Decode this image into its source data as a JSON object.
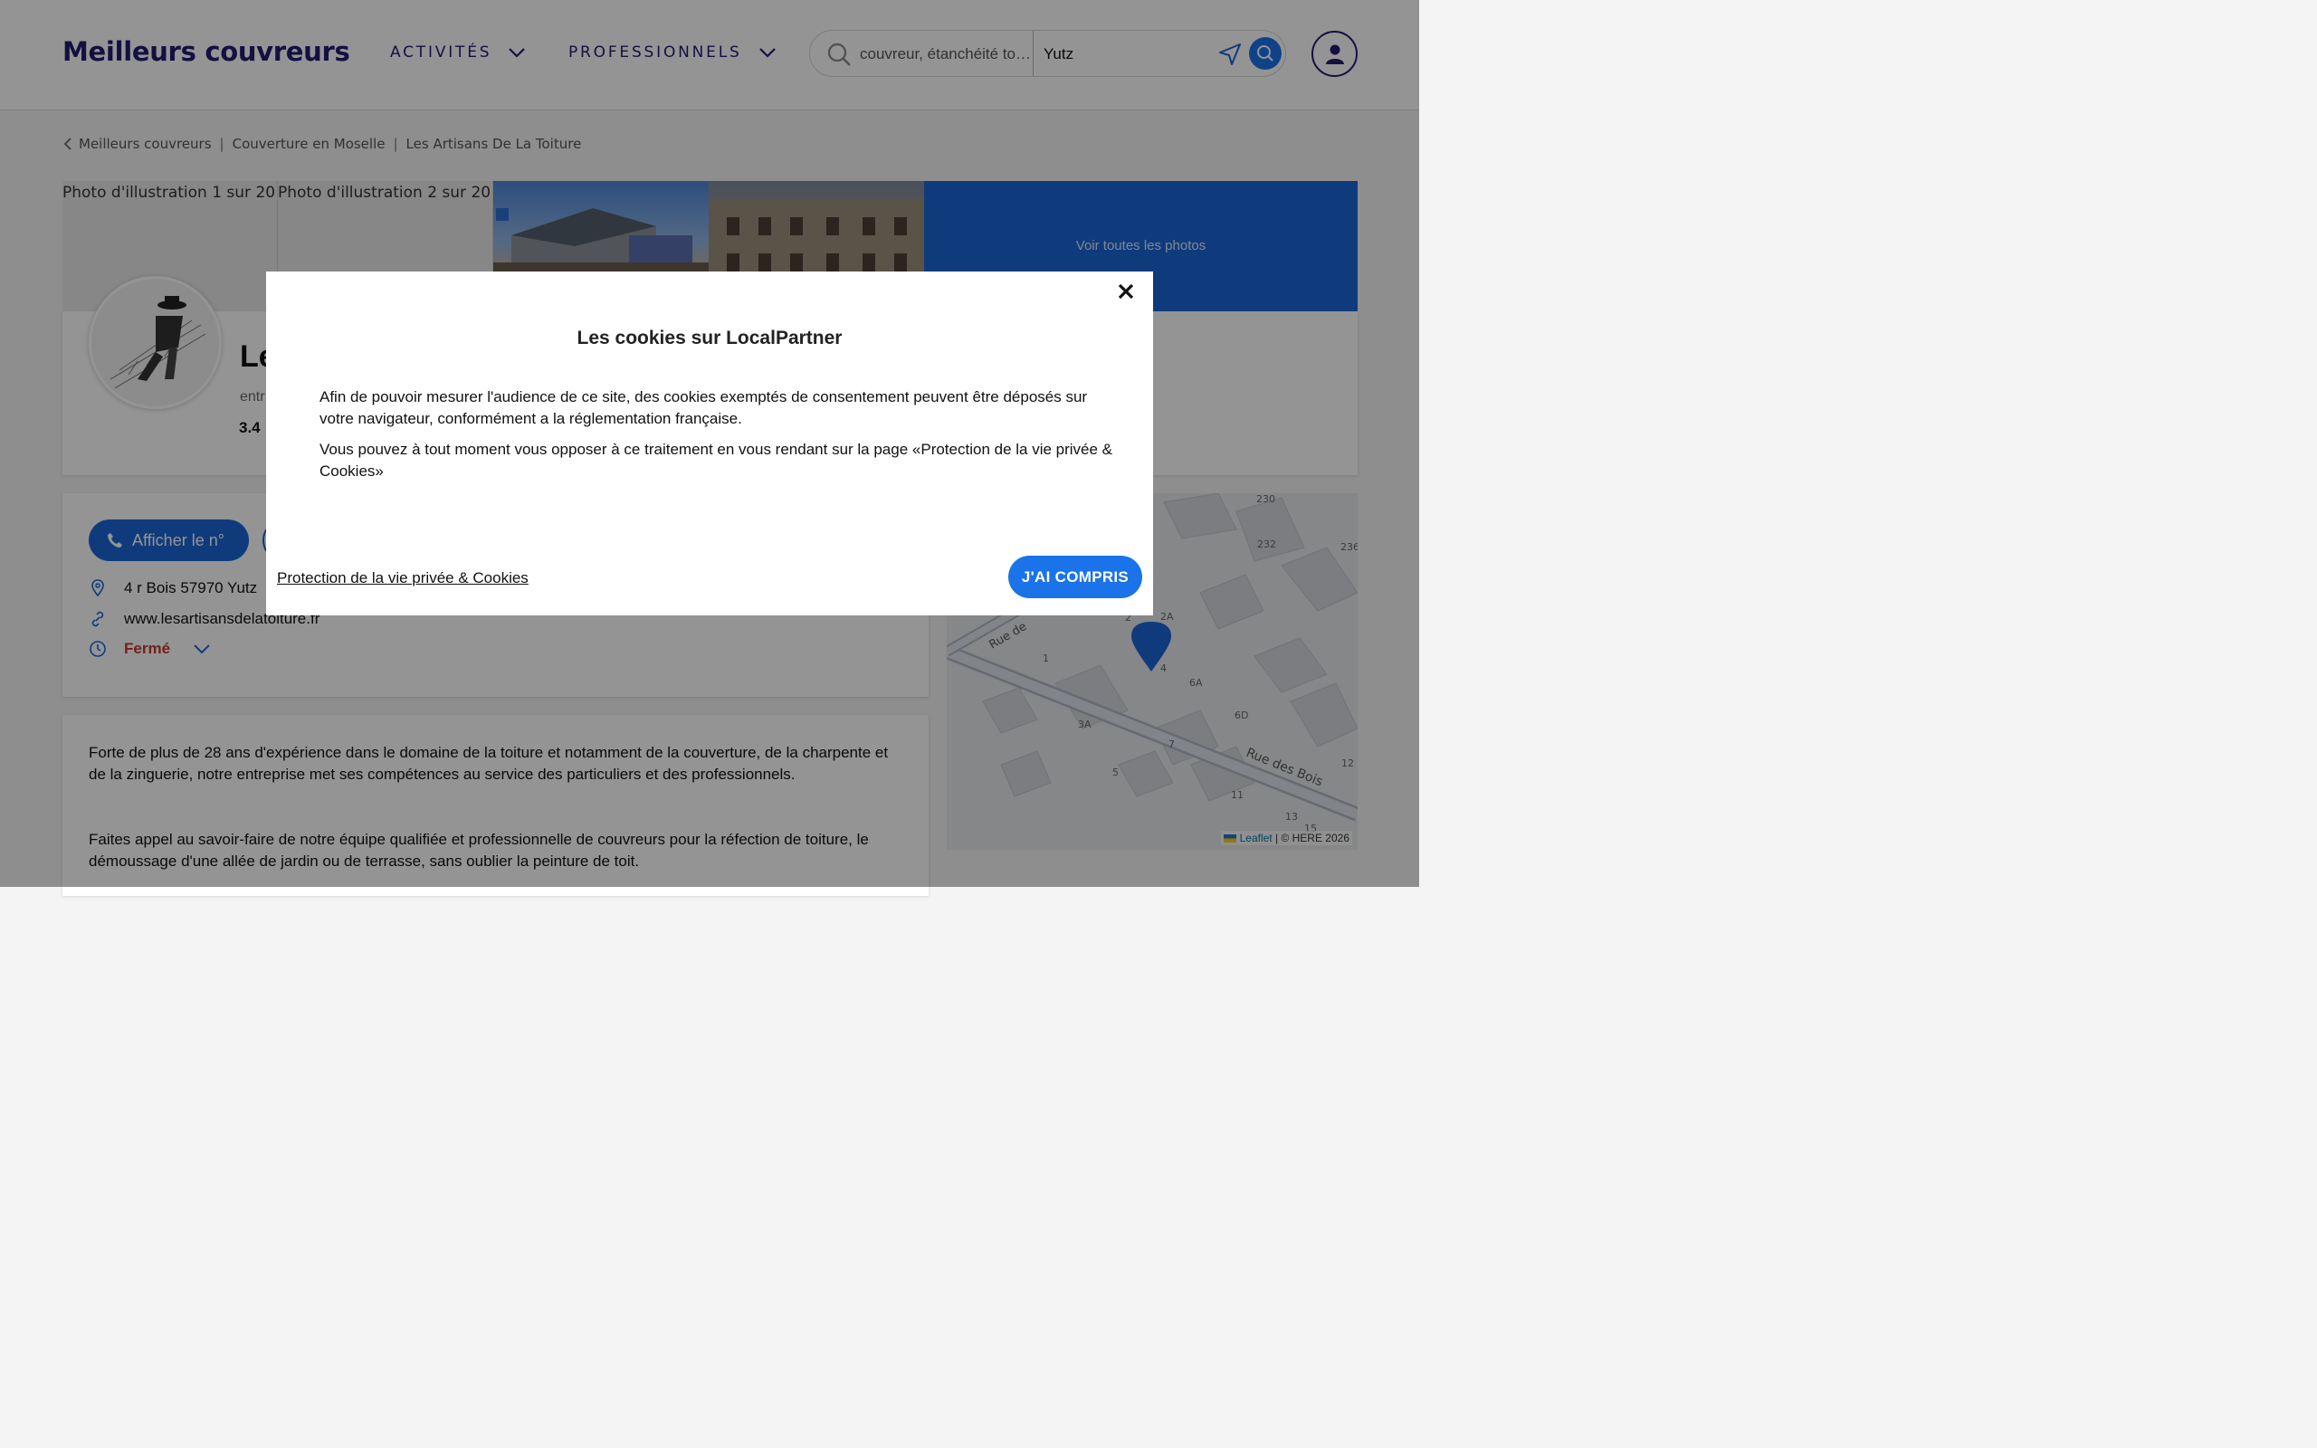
{
  "header": {
    "logo": "Meilleurs couvreurs",
    "nav": [
      {
        "label": "ACTIVITÉS"
      },
      {
        "label": "PROFESSIONNELS"
      }
    ],
    "search": {
      "what_placeholder": "couvreur, étanchéité toiture",
      "where_value": "Yutz"
    }
  },
  "breadcrumb": [
    "Meilleurs couvreurs",
    "Couverture en Moselle",
    "Les Artisans De La Toiture"
  ],
  "photos": {
    "alt1": "Photo d'illustration 1 sur 20",
    "alt2": "Photo d'illustration 2 sur 20",
    "more": "Voir toutes les photos"
  },
  "business": {
    "name": "Le",
    "subtitle": "entr",
    "rating": "3.4",
    "phone_button": "Afficher le n°",
    "address": "4 r Bois 57970 Yutz",
    "website": "www.lesartisansdelatoiture.fr",
    "hours_status": "Fermé"
  },
  "description": {
    "p1": "Forte de plus de 28 ans d'expérience dans le domaine de la toiture et notamment de la couverture, de la charpente et de la zinguerie, notre entreprise met ses compétences au service des particuliers et des professionnels.",
    "p2": "Faites appel au savoir-faire de notre équipe qualifiée et professionnelle de couvreurs pour la réfection de toiture, le démoussage d'une allée de jardin ou de terrasse, sans oublier la peinture de toit."
  },
  "map": {
    "street": "Rue des Bois",
    "street2": "Rue de",
    "numbers": [
      "230",
      "232",
      "236",
      "2",
      "2A",
      "1",
      "4",
      "6A",
      "3A",
      "6D",
      "7",
      "5",
      "11",
      "12",
      "13",
      "15"
    ],
    "attribution_leaflet": "Leaflet",
    "attribution_rest": "| © HERE 2026"
  },
  "modal": {
    "title": "Les cookies sur LocalPartner",
    "p1": "Afin de pouvoir mesurer l'audience de ce site, des cookies exemptés de consentement peuvent être déposés sur votre navigateur, conformément a la réglementation française.",
    "p2": "Vous pouvez à tout moment vous opposer à ce traitement en vous rendant sur la page «Protection de la vie privée & Cookies»",
    "privacy_link": "Protection de la vie privée & Cookies",
    "ok_button": "J'AI COMPRIS"
  },
  "colors": {
    "brand_navy": "#221c70",
    "accent_blue": "#1a73e8",
    "closed_red": "#c8372f"
  }
}
